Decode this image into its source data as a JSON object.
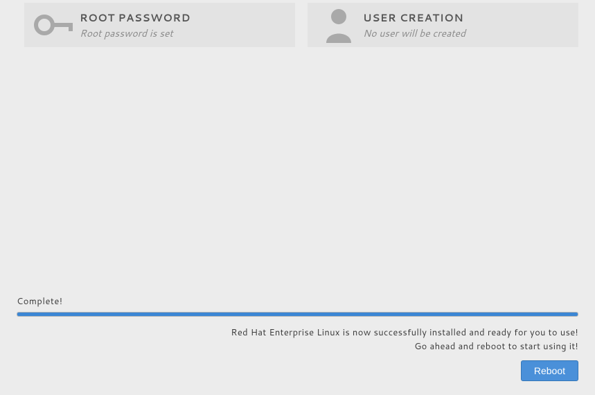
{
  "spokes": {
    "root_password": {
      "title": "ROOT PASSWORD",
      "status": "Root password is set"
    },
    "user_creation": {
      "title": "USER CREATION",
      "status": "No user will be created"
    }
  },
  "progress": {
    "label": "Complete!",
    "percent": 100
  },
  "messages": {
    "line1": "Red Hat Enterprise Linux is now successfully installed and ready for you to use!",
    "line2": "Go ahead and reboot to start using it!"
  },
  "actions": {
    "reboot": "Reboot"
  }
}
